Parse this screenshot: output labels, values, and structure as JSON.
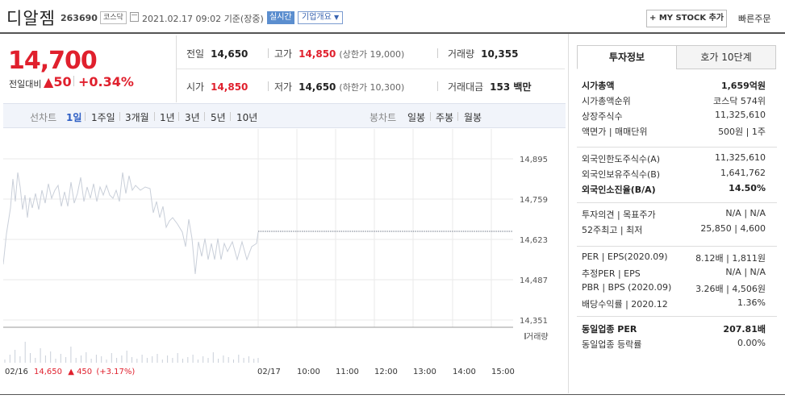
{
  "header": {
    "stock_name": "디알젬",
    "stock_code": "263690",
    "market": "코스닥",
    "datetime": "2021.02.17 09:02",
    "basis": "기준(장중)",
    "realtime_label": "실시간",
    "corp_overview_label": "기업개요",
    "my_stock_label": "+ MY STOCK 추가",
    "quick_order_label": "빠른주문"
  },
  "price": {
    "current": "14,700",
    "change_label": "전일대비",
    "change_value": "50",
    "change_pct": "+0.34%"
  },
  "quote": {
    "prev_label": "전일",
    "prev_value": "14,650",
    "high_label": "고가",
    "high_value": "14,850",
    "upper_limit": "(상한가 19,000)",
    "volume_label": "거래량",
    "volume_value": "10,355",
    "open_label": "시가",
    "open_value": "14,850",
    "low_label": "저가",
    "low_value": "14,650",
    "lower_limit": "(하한가 10,300)",
    "amount_label": "거래대금",
    "amount_value": "153 백만"
  },
  "period_bar": {
    "line_chart_label": "선차트",
    "periods": [
      "1일",
      "1주일",
      "3개월",
      "1년",
      "3년",
      "5년",
      "10년"
    ],
    "candle_chart_label": "봉차트",
    "candles": [
      "일봉",
      "주봉",
      "월봉"
    ]
  },
  "chart": {
    "y_ticks": [
      "14,895",
      "14,759",
      "14,623",
      "14,487",
      "14,351"
    ],
    "volume_label": "거래량",
    "x_ticks": [
      "02/17",
      "10:00",
      "11:00",
      "12:00",
      "13:00",
      "14:00",
      "15:00"
    ],
    "prev_day_summary": {
      "date": "02/16",
      "close": "14,650",
      "change": "▲ 450",
      "pct": "(+3.17%)"
    }
  },
  "chart_data": {
    "type": "line",
    "y_range": [
      14351,
      14895
    ],
    "prev_day_close": 14650,
    "intraday_current": 14700
  },
  "side": {
    "tab_invest": "투자정보",
    "tab_quote": "호가 10단계",
    "rows1": [
      {
        "k": "시가총액",
        "v": "1,659억원",
        "bold": true
      },
      {
        "k": "시가총액순위",
        "v": "코스닥 574위"
      },
      {
        "k": "상장주식수",
        "v": "11,325,610"
      },
      {
        "k": "액면가 | 매매단위",
        "v": "500원 | 1주"
      }
    ],
    "rows2": [
      {
        "k": "외국인한도주식수(A)",
        "v": "11,325,610"
      },
      {
        "k": "외국인보유주식수(B)",
        "v": "1,641,762"
      },
      {
        "k": "외국인소진율(B/A)",
        "v": "14.50%",
        "bold": true
      }
    ],
    "rows3": [
      {
        "k": "투자의견 | 목표주가",
        "v": "N/A | N/A"
      },
      {
        "k": "52주최고 | 최저",
        "v": "25,850 | 4,600"
      }
    ],
    "rows4": [
      {
        "k": "PER | EPS(2020.09)",
        "v": "8.12배 | 1,811원"
      },
      {
        "k": "추정PER | EPS",
        "v": "N/A | N/A"
      },
      {
        "k": "PBR | BPS (2020.09)",
        "v": "3.26배 | 4,506원"
      },
      {
        "k": "배당수익률 | 2020.12",
        "v": "1.36%"
      }
    ],
    "rows5": [
      {
        "k": "동일업종 PER",
        "v": "207.81배",
        "bold": true
      },
      {
        "k": "동일업종 등락률",
        "v": "0.00%"
      }
    ]
  },
  "colors": {
    "up": "#e0202d",
    "accent": "#2f5fc4",
    "line": "#c9cfd9"
  }
}
